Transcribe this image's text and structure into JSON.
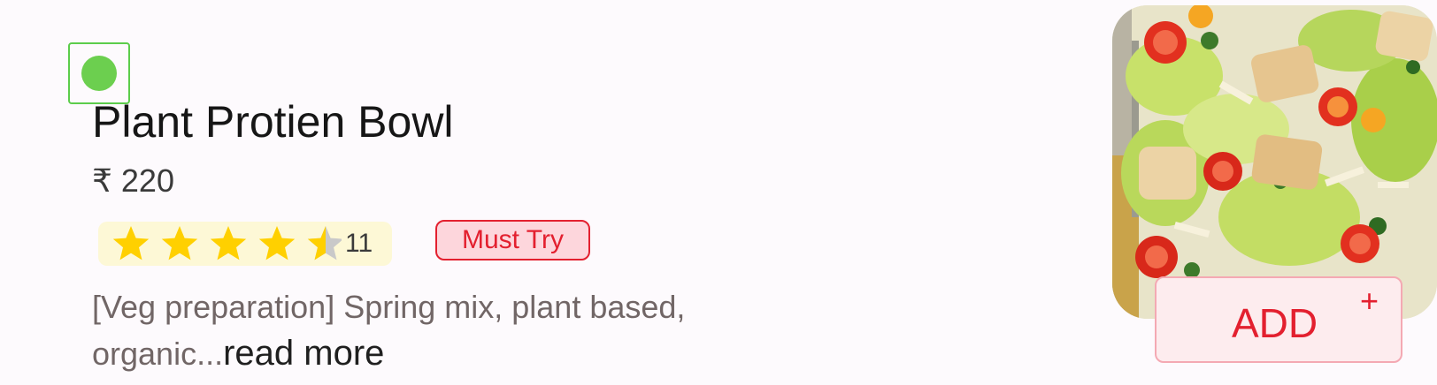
{
  "item": {
    "veg_indicator_color": "#6ccf4f",
    "name": "Plant Protien Bowl",
    "price": "₹ 220",
    "rating": {
      "stars": 4.5,
      "max_stars": 5,
      "count": "11",
      "star_color": "#ffd000"
    },
    "tag": "Must Try",
    "description_text": "[Veg preparation] Spring mix, plant based, organic...",
    "read_more": "read more",
    "image_icon": "salad-bowl-photo"
  },
  "actions": {
    "add_label": "ADD",
    "add_plus": "+",
    "accent_color": "#e3202f"
  }
}
